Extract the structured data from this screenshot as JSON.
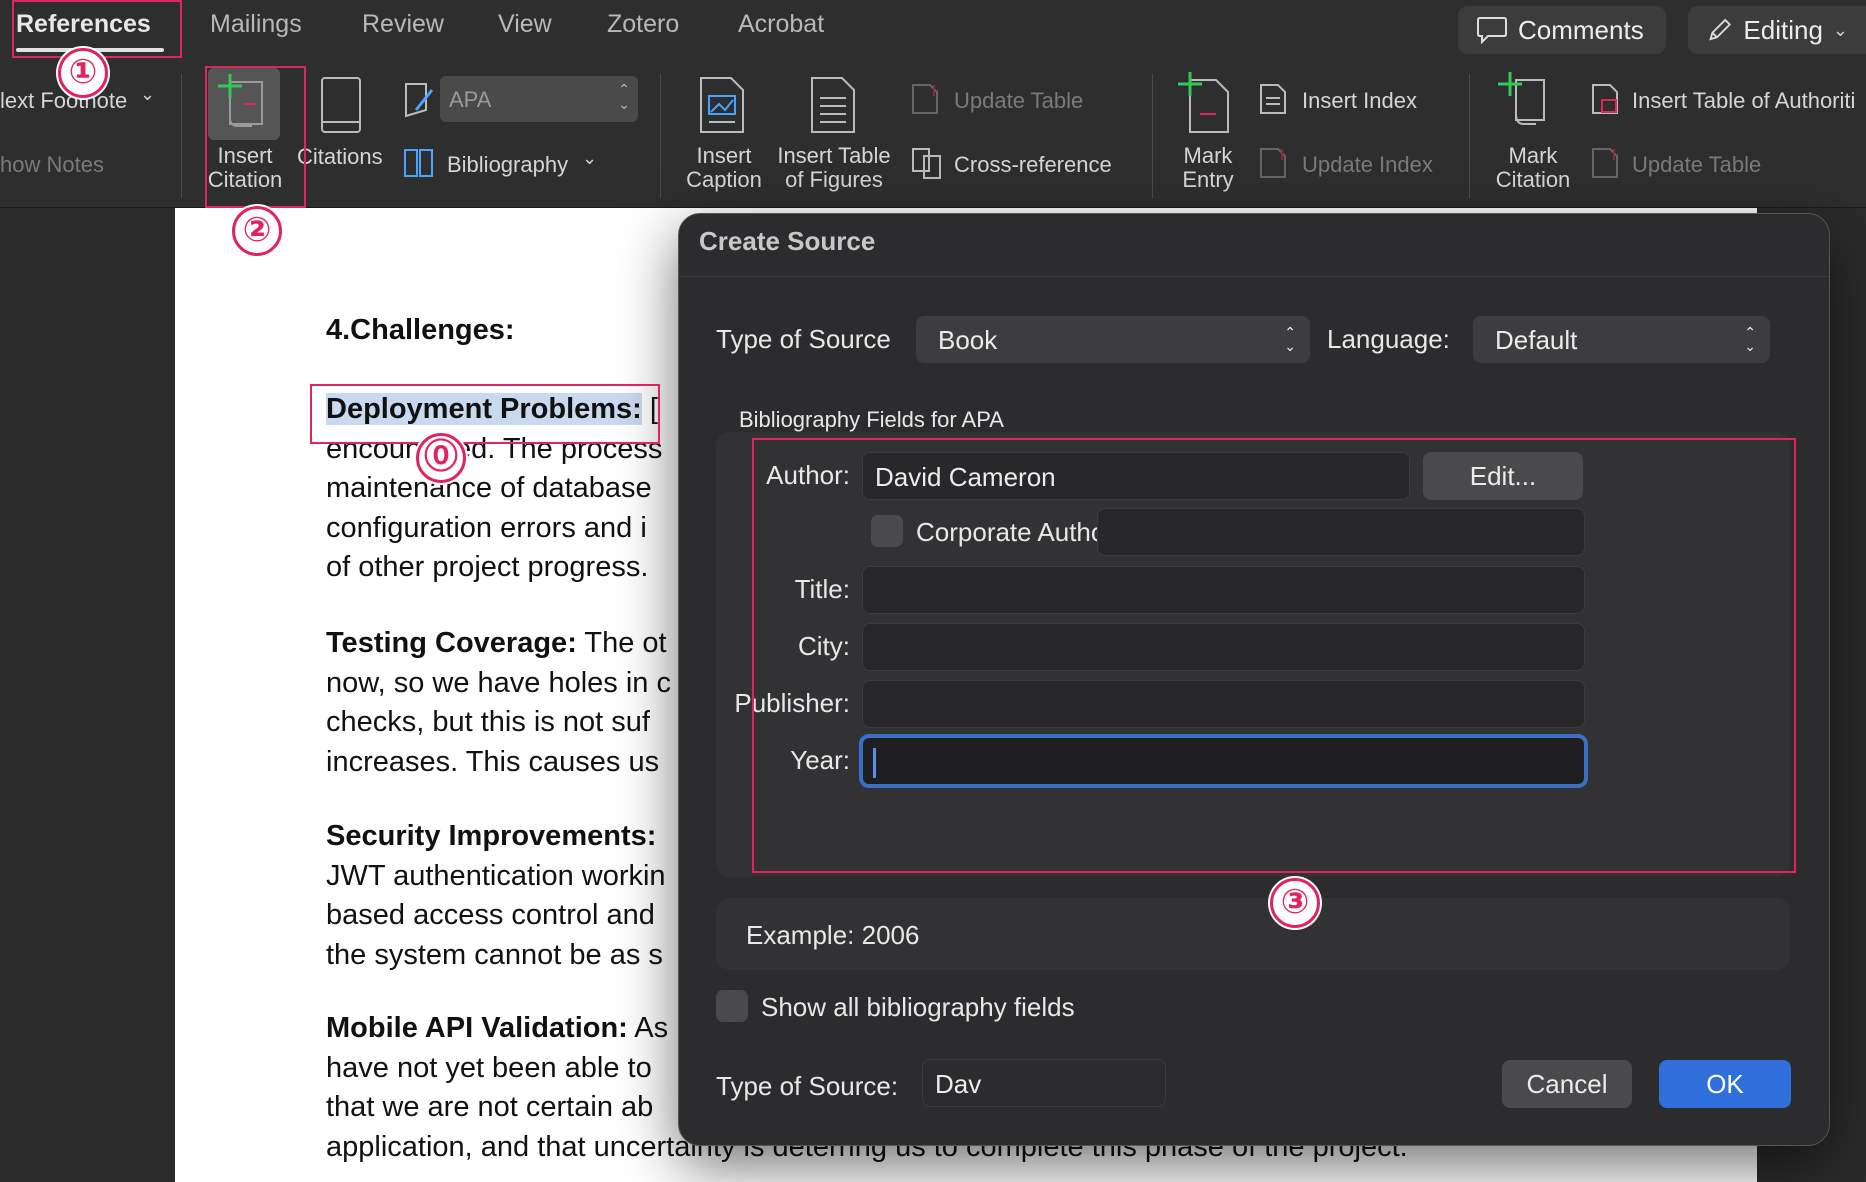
{
  "ribbon": {
    "tabs": [
      {
        "label": "References",
        "active": true
      },
      {
        "label": "Mailings"
      },
      {
        "label": "Review"
      },
      {
        "label": "View"
      },
      {
        "label": "Zotero"
      },
      {
        "label": "Acrobat"
      }
    ],
    "comments_label": "Comments",
    "editing_label": "Editing",
    "next_footnote": "lext Footnote",
    "show_notes": "how Notes",
    "insert_citation": [
      "Insert",
      "Citation"
    ],
    "citations": "Citations",
    "style_value": "APA",
    "bibliography": "Bibliography",
    "insert_caption": [
      "Insert",
      "Caption"
    ],
    "insert_table_of_figures": [
      "Insert Table",
      "of Figures"
    ],
    "update_table_captions": "Update Table",
    "cross_reference": "Cross-reference",
    "mark_entry": [
      "Mark",
      "Entry"
    ],
    "insert_index": "Insert Index",
    "update_index": "Update Index",
    "mark_citation": [
      "Mark",
      "Citation"
    ],
    "insert_table_of_authorities": "Insert Table of Authoriti",
    "update_table_authorities": "Update Table"
  },
  "annotations": [
    "①",
    "②",
    "⓪",
    "③"
  ],
  "document": {
    "heading": "4.Challenges:",
    "paragraphs": [
      {
        "bold": "Deployment Problems:",
        "rest": " [",
        "lines": [
          "encountered. The process",
          "maintenance of database",
          "configuration errors and i",
          "of other project progress."
        ]
      },
      {
        "bold": "Testing Coverage:",
        "rest": " The ot",
        "lines": [
          "now, so we have holes in c",
          "checks, but this is not suf",
          "increases. This causes us"
        ]
      },
      {
        "bold": "Security Improvements:",
        "rest": "",
        "lines": [
          "JWT authentication workin",
          "based access control and",
          "the system cannot be as s"
        ]
      },
      {
        "bold": "Mobile API Validation:",
        "rest": " As",
        "lines": [
          "have not yet been able to",
          "that we are not certain ab",
          "application, and that uncertainty is deterring us to complete this phase of the project."
        ]
      }
    ]
  },
  "dialog": {
    "title": "Create Source",
    "type_of_source_label": "Type of Source",
    "type_of_source_value": "Book",
    "language_label": "Language:",
    "language_value": "Default",
    "fields_header": "Bibliography Fields for APA",
    "fields": {
      "author_label": "Author:",
      "author_value": "David Cameron",
      "edit_button": "Edit...",
      "corporate_author_label": "Corporate Author:",
      "title_label": "Title:",
      "city_label": "City:",
      "publisher_label": "Publisher:",
      "year_label": "Year:"
    },
    "example": "Example: 2006",
    "show_all_fields": "Show all bibliography fields",
    "tag_label": "Type of Source:",
    "tag_value": "Dav",
    "cancel": "Cancel",
    "ok": "OK"
  },
  "colors": {
    "accent": "#2e6fdb",
    "annotation": "#e0245e",
    "focus_ring": "#3b6fc4"
  }
}
